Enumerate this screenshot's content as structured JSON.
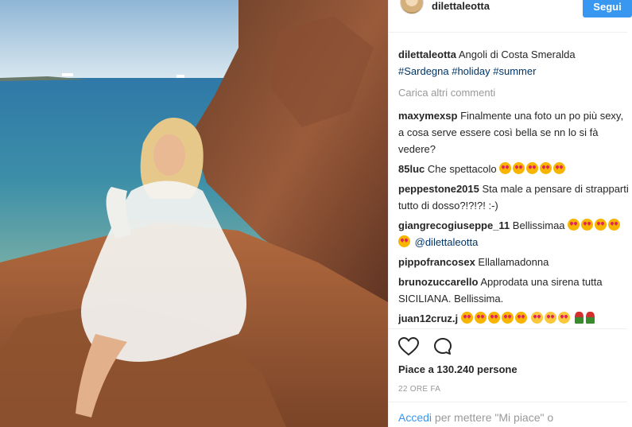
{
  "post": {
    "username": "dilettaleotta",
    "follow_label": "Segui",
    "caption_user": "dilettaleotta",
    "caption_text": "Angoli di Costa Smeralda",
    "caption_tags": "#Sardegna #holiday #summer",
    "load_more": "Carica altri commenti"
  },
  "comments": [
    {
      "user": "maxymexsp",
      "text": "Finalmente una foto un po più sexy, a cosa serve essere così bella se nn lo si fà vedere?"
    },
    {
      "user": "85luc",
      "text": "Che spettacolo",
      "emoji": "heart-eyes-x5"
    },
    {
      "user": "peppestone2015",
      "text": "Sta male a pensare di strapparti tutto di dosso?!?!?! :-)"
    },
    {
      "user": "giangrecogiuseppe_11",
      "text": "Bellissimaa",
      "mention": "@dilettaleotta",
      "emoji": "heart-eyes-x5"
    },
    {
      "user": "pippofrancosex",
      "text": "Ellallamadonna"
    },
    {
      "user": "brunozuccarello",
      "text": "Approdata una sirena tutta SICILIANA. Bellissima."
    },
    {
      "user": "juan12cruz.j",
      "text": "",
      "emoji": "heart-eyes-x5, kiss-x3, rose-x2"
    }
  ],
  "actions": {
    "like_icon": "heart-outline-icon",
    "comment_icon": "speech-bubble-icon"
  },
  "likes": "Piace a 130.240 persone",
  "time": "22 ORE FA",
  "login": {
    "link": "Accedi",
    "rest": "per mettere \"Mi piace\" o"
  },
  "colors": {
    "accent": "#3897f0",
    "hashtag": "#003569",
    "muted": "#999999"
  }
}
